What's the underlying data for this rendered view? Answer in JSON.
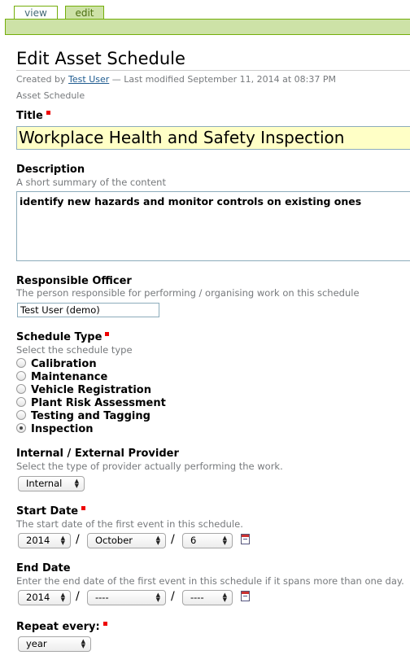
{
  "tabs": {
    "view": "view",
    "edit": "edit"
  },
  "page_title": "Edit Asset Schedule",
  "byline": {
    "prefix": "Created by",
    "author": "Test User",
    "modified": "— Last modified September 11, 2014 at 08:37 PM"
  },
  "doc_type": "Asset Schedule",
  "fields": {
    "title": {
      "label": "Title",
      "value": "Workplace Health and Safety Inspection"
    },
    "description": {
      "label": "Description",
      "help": "A short summary of the content",
      "value": "identify new hazards and monitor controls on existing ones"
    },
    "officer": {
      "label": "Responsible Officer",
      "help": "The person responsible for performing / organising work on this schedule",
      "value": "Test User (demo)"
    },
    "schedule_type": {
      "label": "Schedule Type",
      "help": "Select the schedule type",
      "options": [
        "Calibration",
        "Maintenance",
        "Vehicle Registration",
        "Plant Risk Assessment",
        "Testing and Tagging",
        "Inspection"
      ],
      "selected": "Inspection"
    },
    "provider": {
      "label": "Internal / External Provider",
      "help": "Select the type of provider actually performing the work.",
      "value": "Internal"
    },
    "start_date": {
      "label": "Start Date",
      "help": "The start date of the first event in this schedule.",
      "year": "2014",
      "month": "October",
      "day": "6",
      "sep": "/"
    },
    "end_date": {
      "label": "End Date",
      "help": "Enter the end date of the first event in this schedule if it spans more than one day.",
      "year": "2014",
      "month": "----",
      "day": "----",
      "sep": "/"
    },
    "repeat": {
      "label": "Repeat every:",
      "value": "year"
    }
  },
  "colors": {
    "accent": "#cde2a7",
    "border": "#74ae0b",
    "required": "#e00000",
    "title_bg": "#ffffc6"
  },
  "icons": {
    "calendar": "calendar-icon",
    "required": "required-marker"
  }
}
